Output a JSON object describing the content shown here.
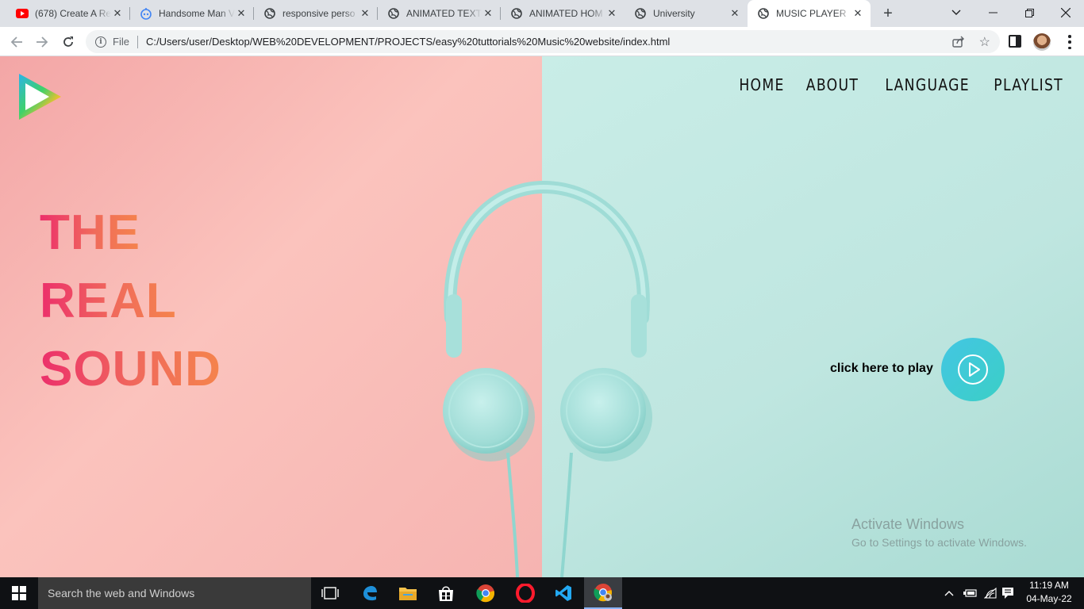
{
  "browser": {
    "tabs": [
      {
        "title": "(678) Create A Re",
        "icon": "youtube-icon"
      },
      {
        "title": "Handsome Man V",
        "icon": "bot-icon"
      },
      {
        "title": "responsive perso",
        "icon": "globe-icon"
      },
      {
        "title": "ANIMATED TEXT",
        "icon": "globe-icon"
      },
      {
        "title": "ANIMATED HOM",
        "icon": "globe-icon"
      },
      {
        "title": "University",
        "icon": "globe-icon"
      },
      {
        "title": "MUSIC PLAYER",
        "icon": "globe-icon",
        "active": true
      }
    ],
    "address": {
      "protocol_label": "File",
      "url": "C:/Users/user/Desktop/WEB%20DEVELOPMENT/PROJECTS/easy%20tuttorials%20Music%20website/index.html"
    }
  },
  "site": {
    "nav": [
      "HOME",
      "ABOUT",
      "LANGUAGE",
      "PLAYLIST"
    ],
    "hero": [
      "THE",
      "REAL",
      "SOUND"
    ],
    "play_label": "click here to play",
    "colors": {
      "left_bg": "#fbc3bd",
      "right_bg": "#c4e9e3",
      "hero_gradient_start": "#ec2f6b",
      "hero_gradient_end": "#f5844c",
      "play_button": "#3fcad8"
    }
  },
  "watermark": {
    "line1": "Activate Windows",
    "line2": "Go to Settings to activate Windows."
  },
  "taskbar": {
    "search_placeholder": "Search the web and Windows",
    "time": "11:19 AM",
    "date": "04-May-22"
  }
}
